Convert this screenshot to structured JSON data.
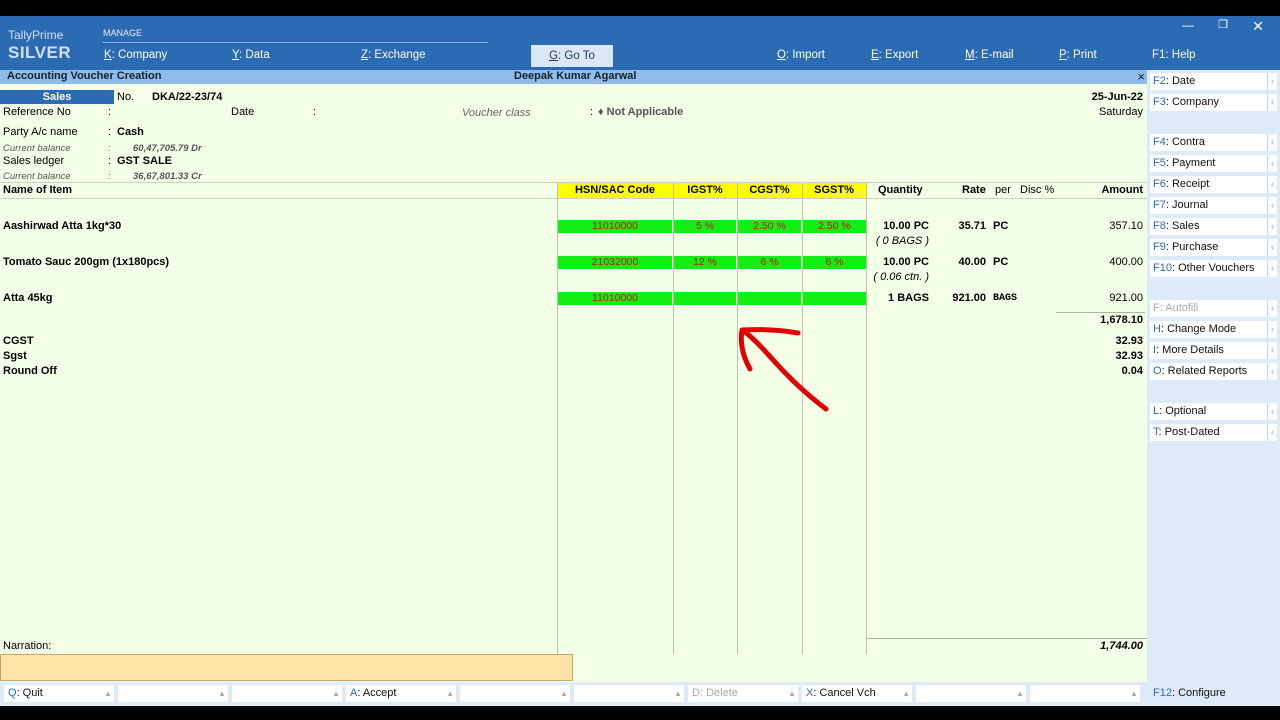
{
  "app": {
    "brand_top": "TallyPrime",
    "brand_edition": "SILVER",
    "manage_label": "MANAGE",
    "menu": [
      {
        "key": "K",
        "label": ": Company"
      },
      {
        "key": "Y",
        "label": ": Data"
      },
      {
        "key": "Z",
        "label": ": Exchange"
      },
      {
        "key": "G",
        "label": ": Go To"
      },
      {
        "key": "O",
        "label": ": Import"
      },
      {
        "key": "E",
        "label": ": Export"
      },
      {
        "key": "M",
        "label": ": E-mail"
      },
      {
        "key": "P",
        "label": ": Print"
      },
      {
        "key": "F1",
        "label": ": Help"
      }
    ]
  },
  "titlebar": {
    "screen": "Accounting Voucher Creation",
    "company": "Deepak Kumar Agarwal",
    "close": "×"
  },
  "voucher": {
    "type": "Sales",
    "no_label": "No.",
    "no": "DKA/22-23/74",
    "date": "25-Jun-22",
    "day": "Saturday",
    "ref_label": "Reference No",
    "colon": ":",
    "date_label": "Date",
    "class_label": "Voucher class",
    "class_value": "♦ Not Applicable",
    "party_label": "Party A/c name",
    "party": "Cash",
    "cur_bal_label": "Current balance",
    "party_balance": "60,47,705.79 Dr",
    "ledger_label": "Sales ledger",
    "ledger": "GST SALE",
    "ledger_balance": "36,67,801.33 Cr"
  },
  "table": {
    "headers": {
      "name": "Name of Item",
      "hsn": "HSN/SAC Code",
      "igst": "IGST%",
      "cgst": "CGST%",
      "sgst": "SGST%",
      "qty": "Quantity",
      "rate": "Rate",
      "per": "per",
      "disc": "Disc %",
      "amount": "Amount"
    },
    "rows": [
      {
        "name": "Aashirwad Atta 1kg*30",
        "hsn": "11010000",
        "igst": "5 %",
        "cgst": "2.50 %",
        "sgst": "2.50 %",
        "qty": "10.00 PC",
        "qty_alt": "( 0 BAGS )",
        "rate": "35.71",
        "per": "PC",
        "amount": "357.10"
      },
      {
        "name": "Tomato Sauc 200gm (1x180pcs)",
        "hsn": "21032000",
        "igst": "12 %",
        "cgst": "6 %",
        "sgst": "6 %",
        "qty": "10.00 PC",
        "qty_alt": "( 0.06 ctn. )",
        "rate": "40.00",
        "per": "PC",
        "amount": "400.00"
      },
      {
        "name": "Atta 45kg",
        "hsn": "11010000",
        "igst": "",
        "cgst": "",
        "sgst": "",
        "qty": "1 BAGS",
        "qty_alt": "",
        "rate": "921.00",
        "per": "BAGS",
        "amount": "921.00"
      }
    ],
    "subtotal": "1,678.10",
    "ledgers": [
      {
        "name": "CGST",
        "amount": "32.93"
      },
      {
        "name": "Sgst",
        "amount": "32.93"
      },
      {
        "name": "Round Off",
        "amount": "0.04"
      }
    ],
    "total": "1,744.00",
    "narration_label": "Narration:"
  },
  "right_panel": [
    {
      "key": "F2",
      "label": ": Date",
      "disabled": false
    },
    {
      "key": "F3",
      "label": ": Company",
      "disabled": false
    },
    {
      "key": "F4",
      "label": ": Contra",
      "disabled": false
    },
    {
      "key": "F5",
      "label": ": Payment",
      "disabled": false
    },
    {
      "key": "F6",
      "label": ": Receipt",
      "disabled": false
    },
    {
      "key": "F7",
      "label": ": Journal",
      "disabled": false
    },
    {
      "key": "F8",
      "label": ": Sales",
      "disabled": false
    },
    {
      "key": "F9",
      "label": ": Purchase",
      "disabled": false
    },
    {
      "key": "F10",
      "label": ": Other Vouchers",
      "disabled": false
    },
    {
      "key": "F",
      "label": ": Autofill",
      "disabled": true
    },
    {
      "key": "H",
      "label": ": Change Mode",
      "disabled": false
    },
    {
      "key": "I",
      "label": ": More Details",
      "disabled": false
    },
    {
      "key": "O",
      "label": ": Related Reports",
      "disabled": false
    },
    {
      "key": "L",
      "label": ": Optional",
      "disabled": false
    },
    {
      "key": "T",
      "label": ": Post-Dated",
      "disabled": false
    },
    {
      "key": "F12",
      "label": ": Configure",
      "disabled": false
    }
  ],
  "bottom_bar": [
    {
      "key": "Q",
      "label": ": Quit",
      "disabled": false
    },
    {
      "key": "",
      "label": "",
      "disabled": false
    },
    {
      "key": "",
      "label": "",
      "disabled": false
    },
    {
      "key": "A",
      "label": ": Accept",
      "disabled": false
    },
    {
      "key": "",
      "label": "",
      "disabled": false
    },
    {
      "key": "",
      "label": "",
      "disabled": false
    },
    {
      "key": "D",
      "label": ": Delete",
      "disabled": true
    },
    {
      "key": "X",
      "label": ": Cancel Vch",
      "disabled": false
    },
    {
      "key": "",
      "label": "",
      "disabled": false
    },
    {
      "key": "",
      "label": "",
      "disabled": false
    }
  ],
  "colors": {
    "brand_blue": "#2b6bb3",
    "field_green": "#11ee11",
    "header_yellow": "#ffff00",
    "background": "#f4ffe8",
    "annotation_arrow": "#e00000"
  }
}
